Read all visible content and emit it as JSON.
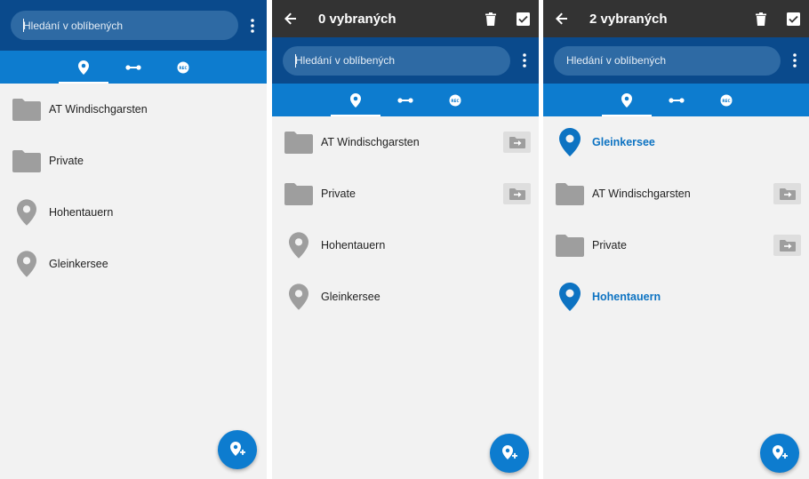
{
  "colors": {
    "appbar": "#333333",
    "header_blue": "#0a4a8c",
    "tab_blue": "#0d7ccf",
    "selected_text": "#0d73c2",
    "icon_grey": "#9e9e9e"
  },
  "search": {
    "placeholder": "Hledání v oblíbených"
  },
  "tabs": [
    "pin-icon",
    "route-icon",
    "rec-icon"
  ],
  "panel1": {
    "items": [
      {
        "type": "folder",
        "label": "AT Windischgarsten"
      },
      {
        "type": "place",
        "label": "Private",
        "icon": "folder"
      },
      {
        "type": "place",
        "label": "Hohentauern"
      },
      {
        "type": "place",
        "label": "Gleinkersee"
      }
    ]
  },
  "panel2": {
    "title": "0 vybraných",
    "items": [
      {
        "label": "AT Windischgarsten"
      },
      {
        "label": "Private"
      },
      {
        "label": "Hohentauern"
      },
      {
        "label": "Gleinkersee"
      }
    ]
  },
  "panel3": {
    "title": "2 vybraných",
    "items": [
      {
        "label": "Gleinkersee",
        "selected": true
      },
      {
        "label": "AT Windischgarsten"
      },
      {
        "label": "Private"
      },
      {
        "label": "Hohentauern",
        "selected": true
      }
    ]
  },
  "rec_text": "REC"
}
